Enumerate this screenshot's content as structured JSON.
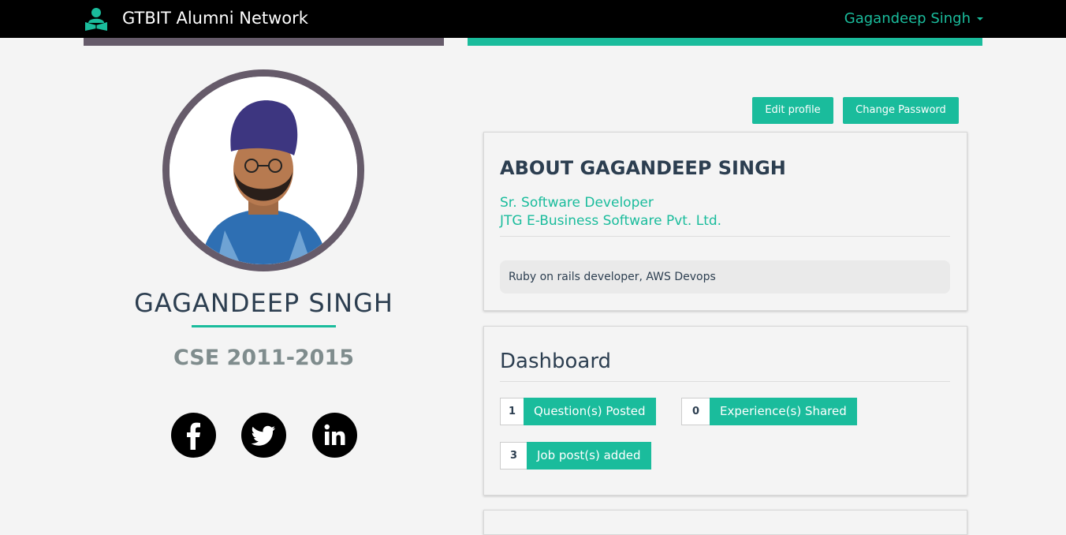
{
  "navbar": {
    "brand": "GTBIT Alumni Network",
    "user_name": "Gagandeep Singh",
    "brand_icon": "graduate-reading-icon",
    "caret_icon": "caret-down-icon"
  },
  "profile": {
    "name": "GAGANDEEP SINGH",
    "batch": "CSE 2011-2015",
    "social": [
      {
        "label": "Facebook",
        "icon": "facebook-icon"
      },
      {
        "label": "Twitter",
        "icon": "twitter-icon"
      },
      {
        "label": "LinkedIn",
        "icon": "linkedin-icon"
      }
    ]
  },
  "actions": {
    "edit_profile": "Edit profile",
    "change_password": "Change Password"
  },
  "about": {
    "title": "ABOUT GAGANDEEP SINGH",
    "role": "Sr. Software Developer",
    "company": "JTG E-Business Software Pvt. Ltd.",
    "bio": "Ruby on rails developer, AWS Devops"
  },
  "dashboard": {
    "title": "Dashboard",
    "stats": [
      {
        "count": "1",
        "label": "Question(s) Posted"
      },
      {
        "count": "0",
        "label": "Experience(s) Shared"
      },
      {
        "count": "3",
        "label": "Job post(s) added"
      }
    ]
  },
  "colors": {
    "accent": "#1abc9c",
    "ring": "#665b6a",
    "navbar": "#000000",
    "heading": "#2c3e50"
  }
}
